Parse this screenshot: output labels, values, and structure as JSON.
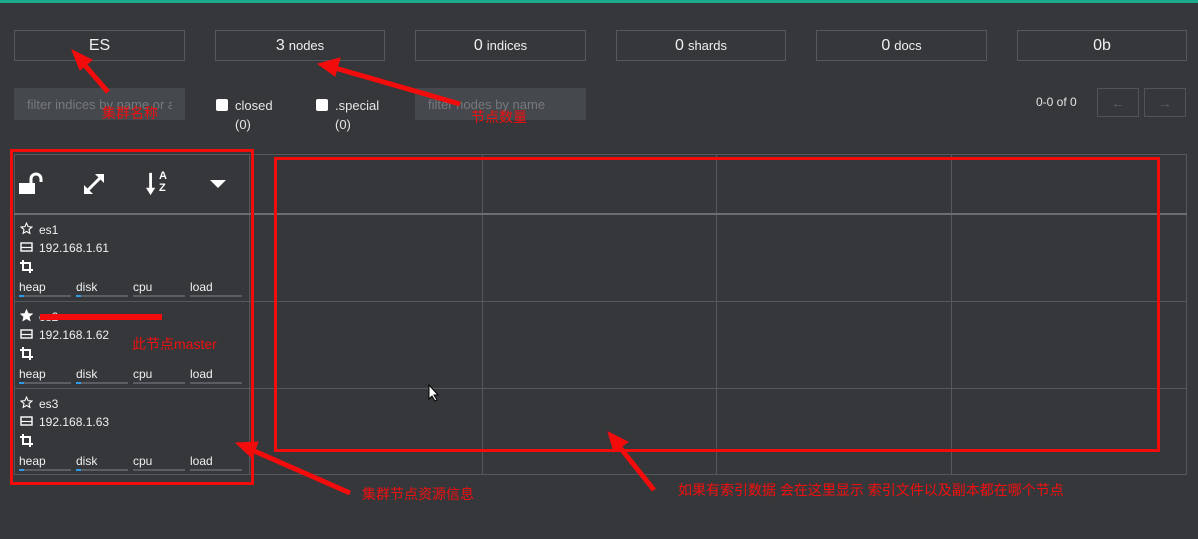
{
  "stats": {
    "cluster_name": "ES",
    "nodes_count": "3",
    "nodes_unit": "nodes",
    "indices_count": "0",
    "indices_unit": "indices",
    "shards_count": "0",
    "shards_unit": "shards",
    "docs_count": "0",
    "docs_unit": "docs",
    "size": "0b"
  },
  "filters": {
    "indices_placeholder": "filter indices by name or aliases",
    "closed_label": "closed",
    "closed_count": "(0)",
    "special_label": ".special",
    "special_count": "(0)",
    "nodes_placeholder": "filter nodes by name"
  },
  "pager": {
    "range_text": "0-0 of 0",
    "prev_icon": "←",
    "next_icon": "→"
  },
  "toolbar": {
    "icons": [
      "unlock-icon",
      "expand-icon",
      "sort-alpha-icon",
      "caret-down-icon"
    ],
    "sort_letters": "AZ"
  },
  "nodes": [
    {
      "name": "es1",
      "ip": "192.168.1.61",
      "master": false,
      "metrics": [
        {
          "label": "heap",
          "level": 0.1
        },
        {
          "label": "disk",
          "level": 0.1
        },
        {
          "label": "cpu",
          "level": 0
        },
        {
          "label": "load",
          "level": 0
        }
      ]
    },
    {
      "name": "es2",
      "ip": "192.168.1.62",
      "master": true,
      "metrics": [
        {
          "label": "heap",
          "level": 0.1
        },
        {
          "label": "disk",
          "level": 0.1
        },
        {
          "label": "cpu",
          "level": 0
        },
        {
          "label": "load",
          "level": 0
        }
      ]
    },
    {
      "name": "es3",
      "ip": "192.168.1.63",
      "master": false,
      "metrics": [
        {
          "label": "heap",
          "level": 0.1
        },
        {
          "label": "disk",
          "level": 0.1
        },
        {
          "label": "cpu",
          "level": 0
        },
        {
          "label": "load",
          "level": 0
        }
      ]
    }
  ],
  "annotations": {
    "cluster_name_note": "集群名称",
    "node_count_note": "节点数量",
    "master_note": "此节点master",
    "node_resources_note": "集群节点资源信息",
    "index_area_note": "如果有索引数据 会在这里显示 索引文件以及副本都在哪个节点"
  },
  "colors": {
    "accent": "#1aa98a",
    "background": "#35373a",
    "annotation": "#f20c0c",
    "metric_fill": "#2e9be6"
  }
}
